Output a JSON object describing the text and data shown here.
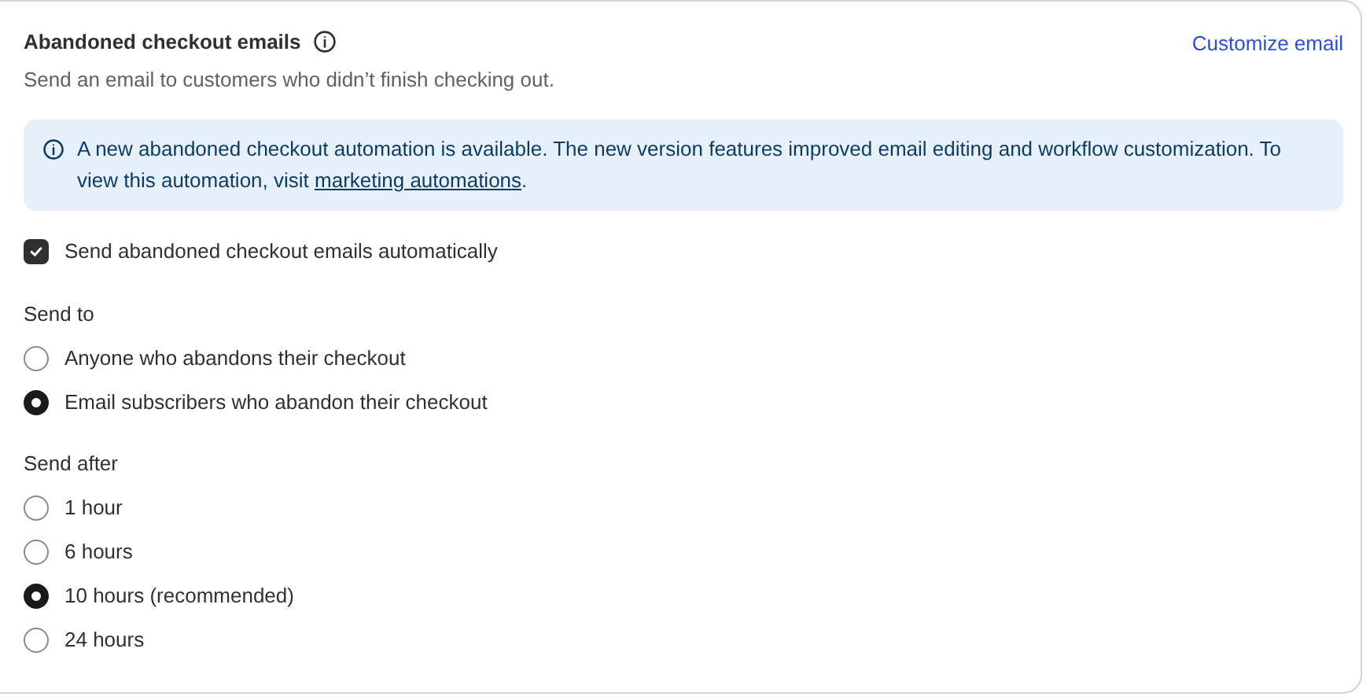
{
  "header": {
    "title": "Abandoned checkout emails",
    "subtitle": "Send an email to customers who didn’t finish checking out.",
    "action": "Customize email"
  },
  "banner": {
    "text": "A new abandoned checkout automation is available. The new version features improved email editing and workflow customization. To view this automation, visit ",
    "link": "marketing automations",
    "text_after": "."
  },
  "auto_send": {
    "label": "Send abandoned checkout emails automatically",
    "checked": true
  },
  "groups": [
    {
      "title": "Send to",
      "options": [
        {
          "label": "Anyone who abandons their checkout",
          "selected": false
        },
        {
          "label": "Email subscribers who abandon their checkout",
          "selected": true
        }
      ]
    },
    {
      "title": "Send after",
      "options": [
        {
          "label": "1 hour",
          "selected": false
        },
        {
          "label": "6 hours",
          "selected": false
        },
        {
          "label": "10 hours (recommended)",
          "selected": true
        },
        {
          "label": "24 hours",
          "selected": false
        }
      ]
    }
  ]
}
